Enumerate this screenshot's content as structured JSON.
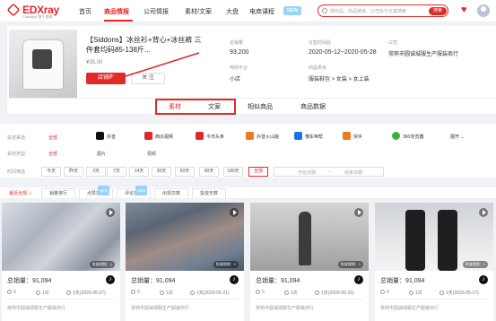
{
  "nav": {
    "logo": "EDXray",
    "logo_sub": "DataBye 数千里眼",
    "items": [
      {
        "label": "首页",
        "active": false
      },
      {
        "label": "商品情报",
        "active": true
      },
      {
        "label": "公司情报",
        "active": false
      },
      {
        "label": "素材/文案",
        "active": false
      },
      {
        "label": "大盘",
        "active": false
      },
      {
        "label": "电商课程",
        "active": false
      }
    ],
    "new_badge": "NEW",
    "search_placeholder": "搜商品、商品链接、公司名与文案搜索",
    "search_button": "搜索"
  },
  "product": {
    "title": "【Siddons】冰丝衫+背心+冰丝裤 三件套均码85-138斤...",
    "price": "¥35.00",
    "primary_button": "店铺购",
    "secondary_button": "关 注",
    "sales_label": "总销量",
    "sales_value": "93,200",
    "online_label": "在售时间段",
    "online_value": "2020-05-12~2020-05-28",
    "company_label": "公司",
    "company_value": "常熟市圆诚城服生产服装商行",
    "platform_label": "电商平台",
    "platform_value": "小店",
    "category_label": "商品类目",
    "category_value": "服装鞋包 > 女装 > 女上装"
  },
  "tabs": [
    {
      "label": "素材",
      "active": true
    },
    {
      "label": "文案",
      "active": false
    },
    {
      "label": "相似商品",
      "active": false
    },
    {
      "label": "商品数据",
      "active": false
    }
  ],
  "filters": {
    "channel_label": "投放渠道:",
    "all": "全部",
    "platforms": [
      {
        "name": "抖音",
        "color": "#111111",
        "icon": "douyin-icon"
      },
      {
        "name": "西瓜视频",
        "color": "#e02a2a",
        "icon": "xigua-icon"
      },
      {
        "name": "今日头条",
        "color": "#e02a2a",
        "icon": "toutiao-icon"
      },
      {
        "name": "抖音火山版",
        "color": "#f07a1a",
        "icon": "huoshan-icon"
      },
      {
        "name": "懂车帝帮",
        "color": "#1a73e8",
        "icon": "dongchedi-icon"
      },
      {
        "name": "快手",
        "color": "#f07a1a",
        "icon": "kuaishou-icon"
      },
      {
        "name": "360浏览器",
        "color": "#3cb043",
        "icon": "browser360-icon"
      }
    ],
    "expand": "展开",
    "type_label": "素材类型:",
    "types": [
      "全部",
      "图片",
      "视频"
    ],
    "time_label": "时间筛选",
    "times": [
      {
        "label": "今天",
        "active": false
      },
      {
        "label": "昨天",
        "active": false
      },
      {
        "label": "3天",
        "active": false
      },
      {
        "label": "7天",
        "active": false
      },
      {
        "label": "14天",
        "active": false
      },
      {
        "label": "30天",
        "active": false
      },
      {
        "label": "60天",
        "active": false
      },
      {
        "label": "90天",
        "active": false
      },
      {
        "label": "180天",
        "active": false
      },
      {
        "label": "全部",
        "active": true
      }
    ],
    "start_date": "开始日期",
    "range_sep": "~",
    "end_date": "结束日期"
  },
  "sort": [
    {
      "label": "最近出现 ⇂",
      "active": true,
      "new": false
    },
    {
      "label": "销量排行",
      "active": false,
      "new": false
    },
    {
      "label": "点赞排行",
      "active": false,
      "new": true
    },
    {
      "label": "评论排行",
      "active": false,
      "new": true
    },
    {
      "label": "出现次数",
      "active": false,
      "new": false
    },
    {
      "label": "投放天数",
      "active": false,
      "new": false
    }
  ],
  "sort_new": "NEW",
  "cards": [
    {
      "cover_tag": "投放视频：1",
      "sales": "总销量：91,094",
      "likes": "0",
      "comments": "1次",
      "date": "1天(2020-05-27)",
      "shop": "常熟市圆诚城服生产服装商行"
    },
    {
      "cover_tag": "投放视频：1",
      "sales": "总销量：91,094",
      "likes": "0",
      "comments": "1次",
      "date": "1天(2020-05-21)",
      "shop": "常熟市圆诚城服生产服装商行"
    },
    {
      "cover_tag": "投放视频：1",
      "sales": "总销量：91,094",
      "likes": "0",
      "comments": "1次",
      "date": "1天(2020-05-16)",
      "shop": "常熟市圆诚城服生产服装商行"
    },
    {
      "cover_tag": "投放视频：1",
      "sales": "总销量：91,094",
      "likes": "0",
      "comments": "1次",
      "date": "1天(2020-05-17)",
      "shop": "常熟市圆诚城服生产服装商行"
    }
  ],
  "tiktok_glyph": "♪",
  "colors": {
    "accent": "#e02a2a",
    "new_badge": "#9ad3f5"
  }
}
